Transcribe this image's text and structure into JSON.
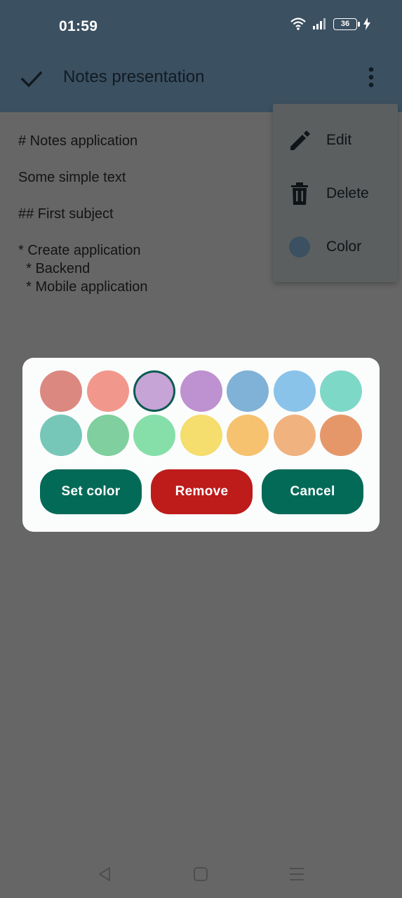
{
  "status_bar": {
    "time": "01:59",
    "battery": "36"
  },
  "app_bar": {
    "title": "Notes presentation"
  },
  "note": {
    "lines": [
      "# Notes application",
      "",
      "Some simple text",
      "",
      "## First subject",
      "",
      "* Create application",
      "  * Backend",
      "  * Mobile application"
    ]
  },
  "menu": {
    "items": [
      {
        "label": "Edit",
        "icon": "pencil-icon"
      },
      {
        "label": "Delete",
        "icon": "trash-icon"
      },
      {
        "label": "Color",
        "icon": "color-dot-icon"
      }
    ]
  },
  "dialog": {
    "swatches": [
      "#db8880",
      "#f2978c",
      "#c7a4d6",
      "#be91d0",
      "#80b1d6",
      "#8ac3ea",
      "#7ed8c8",
      "#77c7b9",
      "#80cf9e",
      "#86dfa9",
      "#f5dd6e",
      "#f6c26f",
      "#f0b27f",
      "#e6976a"
    ],
    "selected_index": 2,
    "buttons": {
      "set_color": "Set color",
      "remove": "Remove",
      "cancel": "Cancel"
    }
  },
  "colors": {
    "app_bar": "#3b5061",
    "scrim_background": "#666666",
    "primary_button": "#046a58",
    "danger_button": "#be1b1b"
  }
}
